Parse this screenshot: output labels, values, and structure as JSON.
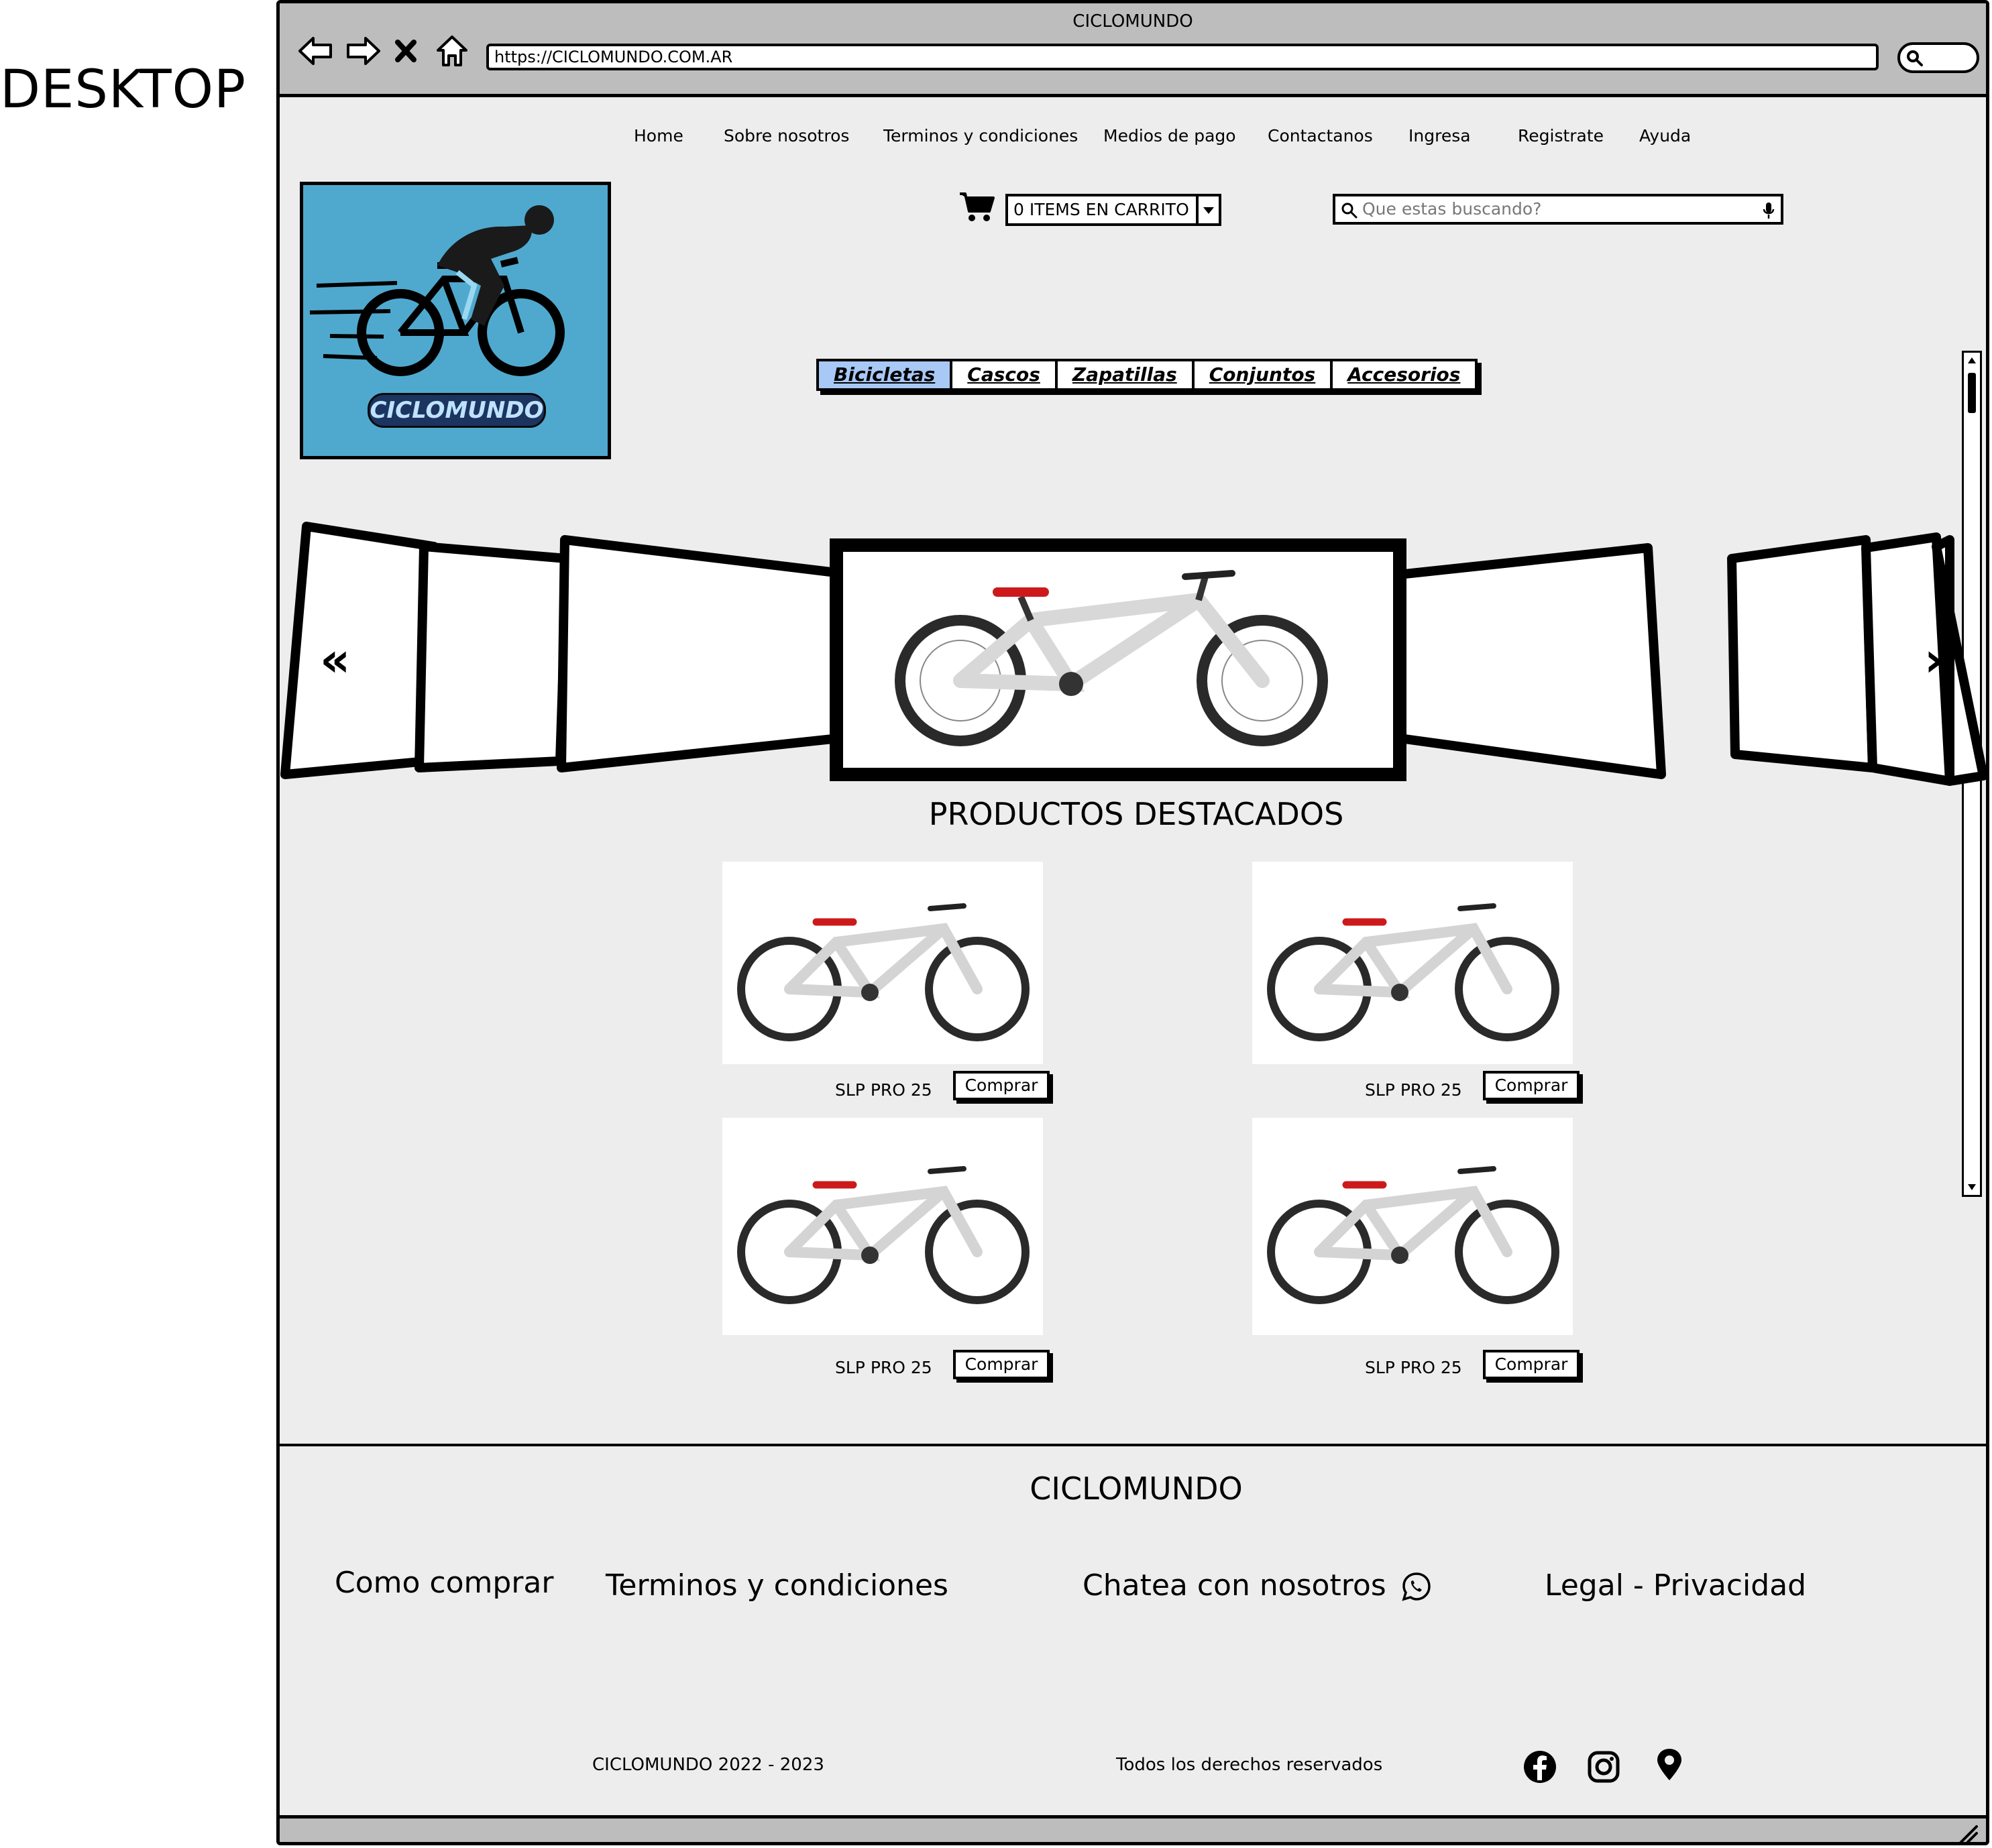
{
  "label": "DESKTOP",
  "browser": {
    "window_title": "CICLOMUNDO",
    "url": "https://CICLOMUNDO.COM.AR"
  },
  "nav": {
    "items": [
      "Home",
      "Sobre nosotros",
      "Terminos y condiciones",
      "Medios de pago",
      "Contactanos",
      "Ingresa",
      "Registrate",
      "Ayuda"
    ]
  },
  "logo": {
    "text": "CICLOMUNDO"
  },
  "cart": {
    "label": "0 ITEMS EN CARRITO"
  },
  "search": {
    "placeholder": "Que estas buscando?"
  },
  "categories": {
    "tabs": [
      "Bicicletas",
      "Cascos",
      "Zapatillas",
      "Conjuntos",
      "Accesorios"
    ],
    "active": "Bicicletas"
  },
  "carousel": {
    "prev": "«",
    "next": "»"
  },
  "featured": {
    "title": "PRODUCTOS DESTACADOS",
    "products": [
      {
        "name": "SLP PRO 25",
        "button": "Comprar"
      },
      {
        "name": "SLP PRO 25",
        "button": "Comprar"
      },
      {
        "name": "SLP PRO 25",
        "button": "Comprar"
      },
      {
        "name": "SLP PRO 25",
        "button": "Comprar"
      }
    ]
  },
  "footer": {
    "title": "CICLOMUNDO",
    "links": [
      "Como comprar",
      "Terminos y condiciones",
      "Chatea con nosotros",
      "Legal - Privacidad"
    ],
    "copyright": "CICLOMUNDO 2022 - 2023",
    "rights": "Todos los derechos reservados"
  }
}
